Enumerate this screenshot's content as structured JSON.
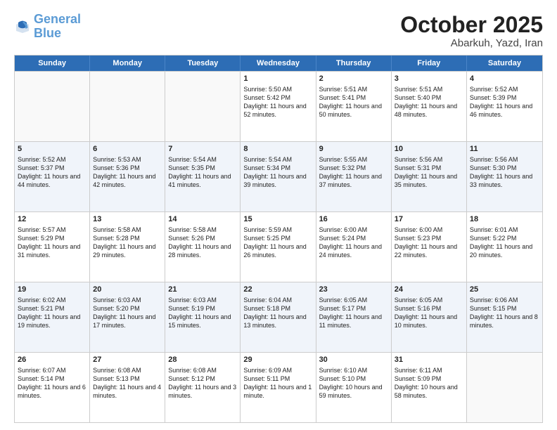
{
  "header": {
    "logo_general": "General",
    "logo_blue": "Blue",
    "month": "October 2025",
    "location": "Abarkuh, Yazd, Iran"
  },
  "weekdays": [
    "Sunday",
    "Monday",
    "Tuesday",
    "Wednesday",
    "Thursday",
    "Friday",
    "Saturday"
  ],
  "rows": [
    [
      {
        "day": "",
        "sunrise": "",
        "sunset": "",
        "daylight": ""
      },
      {
        "day": "",
        "sunrise": "",
        "sunset": "",
        "daylight": ""
      },
      {
        "day": "",
        "sunrise": "",
        "sunset": "",
        "daylight": ""
      },
      {
        "day": "1",
        "sunrise": "Sunrise: 5:50 AM",
        "sunset": "Sunset: 5:42 PM",
        "daylight": "Daylight: 11 hours and 52 minutes."
      },
      {
        "day": "2",
        "sunrise": "Sunrise: 5:51 AM",
        "sunset": "Sunset: 5:41 PM",
        "daylight": "Daylight: 11 hours and 50 minutes."
      },
      {
        "day": "3",
        "sunrise": "Sunrise: 5:51 AM",
        "sunset": "Sunset: 5:40 PM",
        "daylight": "Daylight: 11 hours and 48 minutes."
      },
      {
        "day": "4",
        "sunrise": "Sunrise: 5:52 AM",
        "sunset": "Sunset: 5:39 PM",
        "daylight": "Daylight: 11 hours and 46 minutes."
      }
    ],
    [
      {
        "day": "5",
        "sunrise": "Sunrise: 5:52 AM",
        "sunset": "Sunset: 5:37 PM",
        "daylight": "Daylight: 11 hours and 44 minutes."
      },
      {
        "day": "6",
        "sunrise": "Sunrise: 5:53 AM",
        "sunset": "Sunset: 5:36 PM",
        "daylight": "Daylight: 11 hours and 42 minutes."
      },
      {
        "day": "7",
        "sunrise": "Sunrise: 5:54 AM",
        "sunset": "Sunset: 5:35 PM",
        "daylight": "Daylight: 11 hours and 41 minutes."
      },
      {
        "day": "8",
        "sunrise": "Sunrise: 5:54 AM",
        "sunset": "Sunset: 5:34 PM",
        "daylight": "Daylight: 11 hours and 39 minutes."
      },
      {
        "day": "9",
        "sunrise": "Sunrise: 5:55 AM",
        "sunset": "Sunset: 5:32 PM",
        "daylight": "Daylight: 11 hours and 37 minutes."
      },
      {
        "day": "10",
        "sunrise": "Sunrise: 5:56 AM",
        "sunset": "Sunset: 5:31 PM",
        "daylight": "Daylight: 11 hours and 35 minutes."
      },
      {
        "day": "11",
        "sunrise": "Sunrise: 5:56 AM",
        "sunset": "Sunset: 5:30 PM",
        "daylight": "Daylight: 11 hours and 33 minutes."
      }
    ],
    [
      {
        "day": "12",
        "sunrise": "Sunrise: 5:57 AM",
        "sunset": "Sunset: 5:29 PM",
        "daylight": "Daylight: 11 hours and 31 minutes."
      },
      {
        "day": "13",
        "sunrise": "Sunrise: 5:58 AM",
        "sunset": "Sunset: 5:28 PM",
        "daylight": "Daylight: 11 hours and 29 minutes."
      },
      {
        "day": "14",
        "sunrise": "Sunrise: 5:58 AM",
        "sunset": "Sunset: 5:26 PM",
        "daylight": "Daylight: 11 hours and 28 minutes."
      },
      {
        "day": "15",
        "sunrise": "Sunrise: 5:59 AM",
        "sunset": "Sunset: 5:25 PM",
        "daylight": "Daylight: 11 hours and 26 minutes."
      },
      {
        "day": "16",
        "sunrise": "Sunrise: 6:00 AM",
        "sunset": "Sunset: 5:24 PM",
        "daylight": "Daylight: 11 hours and 24 minutes."
      },
      {
        "day": "17",
        "sunrise": "Sunrise: 6:00 AM",
        "sunset": "Sunset: 5:23 PM",
        "daylight": "Daylight: 11 hours and 22 minutes."
      },
      {
        "day": "18",
        "sunrise": "Sunrise: 6:01 AM",
        "sunset": "Sunset: 5:22 PM",
        "daylight": "Daylight: 11 hours and 20 minutes."
      }
    ],
    [
      {
        "day": "19",
        "sunrise": "Sunrise: 6:02 AM",
        "sunset": "Sunset: 5:21 PM",
        "daylight": "Daylight: 11 hours and 19 minutes."
      },
      {
        "day": "20",
        "sunrise": "Sunrise: 6:03 AM",
        "sunset": "Sunset: 5:20 PM",
        "daylight": "Daylight: 11 hours and 17 minutes."
      },
      {
        "day": "21",
        "sunrise": "Sunrise: 6:03 AM",
        "sunset": "Sunset: 5:19 PM",
        "daylight": "Daylight: 11 hours and 15 minutes."
      },
      {
        "day": "22",
        "sunrise": "Sunrise: 6:04 AM",
        "sunset": "Sunset: 5:18 PM",
        "daylight": "Daylight: 11 hours and 13 minutes."
      },
      {
        "day": "23",
        "sunrise": "Sunrise: 6:05 AM",
        "sunset": "Sunset: 5:17 PM",
        "daylight": "Daylight: 11 hours and 11 minutes."
      },
      {
        "day": "24",
        "sunrise": "Sunrise: 6:05 AM",
        "sunset": "Sunset: 5:16 PM",
        "daylight": "Daylight: 11 hours and 10 minutes."
      },
      {
        "day": "25",
        "sunrise": "Sunrise: 6:06 AM",
        "sunset": "Sunset: 5:15 PM",
        "daylight": "Daylight: 11 hours and 8 minutes."
      }
    ],
    [
      {
        "day": "26",
        "sunrise": "Sunrise: 6:07 AM",
        "sunset": "Sunset: 5:14 PM",
        "daylight": "Daylight: 11 hours and 6 minutes."
      },
      {
        "day": "27",
        "sunrise": "Sunrise: 6:08 AM",
        "sunset": "Sunset: 5:13 PM",
        "daylight": "Daylight: 11 hours and 4 minutes."
      },
      {
        "day": "28",
        "sunrise": "Sunrise: 6:08 AM",
        "sunset": "Sunset: 5:12 PM",
        "daylight": "Daylight: 11 hours and 3 minutes."
      },
      {
        "day": "29",
        "sunrise": "Sunrise: 6:09 AM",
        "sunset": "Sunset: 5:11 PM",
        "daylight": "Daylight: 11 hours and 1 minute."
      },
      {
        "day": "30",
        "sunrise": "Sunrise: 6:10 AM",
        "sunset": "Sunset: 5:10 PM",
        "daylight": "Daylight: 10 hours and 59 minutes."
      },
      {
        "day": "31",
        "sunrise": "Sunrise: 6:11 AM",
        "sunset": "Sunset: 5:09 PM",
        "daylight": "Daylight: 10 hours and 58 minutes."
      },
      {
        "day": "",
        "sunrise": "",
        "sunset": "",
        "daylight": ""
      }
    ]
  ]
}
